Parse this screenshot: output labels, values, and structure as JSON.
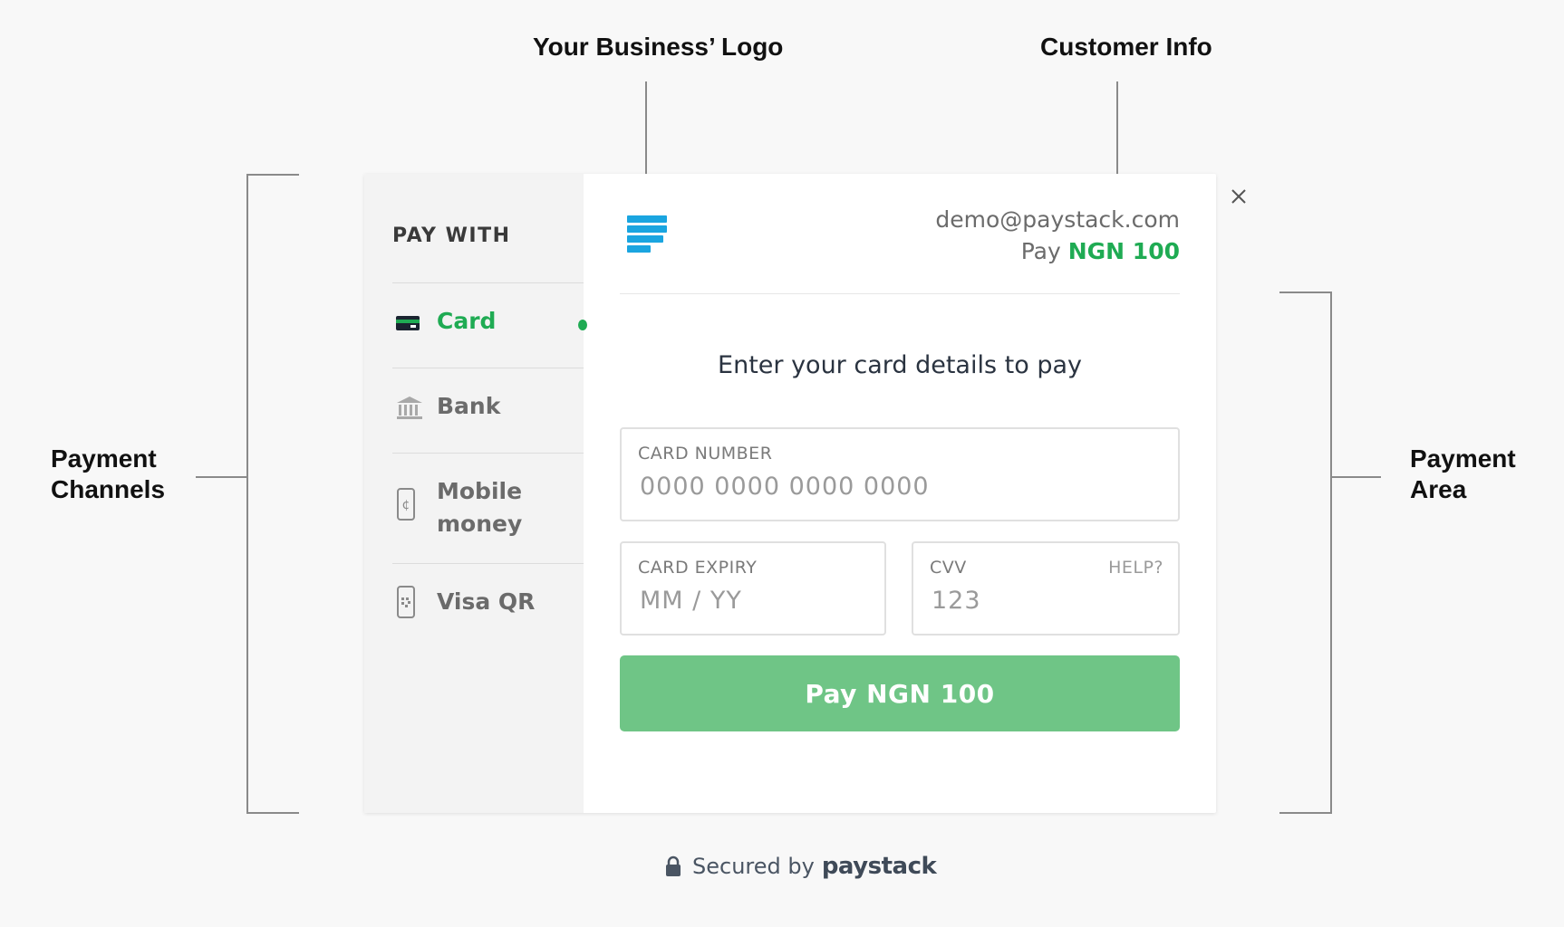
{
  "annotations": {
    "logo": "Your Business’ Logo",
    "customer": "Customer Info",
    "channels_line1": "Payment",
    "channels_line2": "Channels",
    "area_line1": "Payment",
    "area_line2": "Area"
  },
  "sidebar": {
    "heading": "PAY WITH",
    "items": [
      {
        "label": "Card",
        "icon": "card-icon",
        "active": true
      },
      {
        "label": "Bank",
        "icon": "bank-icon",
        "active": false
      },
      {
        "label_line1": "Mobile",
        "label_line2": "money",
        "icon": "mobile-money-icon",
        "active": false
      },
      {
        "label": "Visa QR",
        "icon": "qr-phone-icon",
        "active": false
      }
    ]
  },
  "header": {
    "email": "demo@paystack.com",
    "pay_prefix": "Pay",
    "amount": "NGN 100"
  },
  "form": {
    "prompt": "Enter your card details to pay",
    "card_number": {
      "label": "CARD NUMBER",
      "placeholder": "0000 0000 0000 0000"
    },
    "card_expiry": {
      "label": "CARD EXPIRY",
      "placeholder": "MM / YY"
    },
    "cvv": {
      "label": "CVV",
      "placeholder": "123",
      "help": "HELP?"
    },
    "submit": "Pay NGN 100"
  },
  "footer": {
    "secured_by": "Secured by",
    "brand": "paystack"
  },
  "colors": {
    "accent": "#1fab53",
    "button": "#6fc586",
    "logo": "#1aa5e0"
  }
}
